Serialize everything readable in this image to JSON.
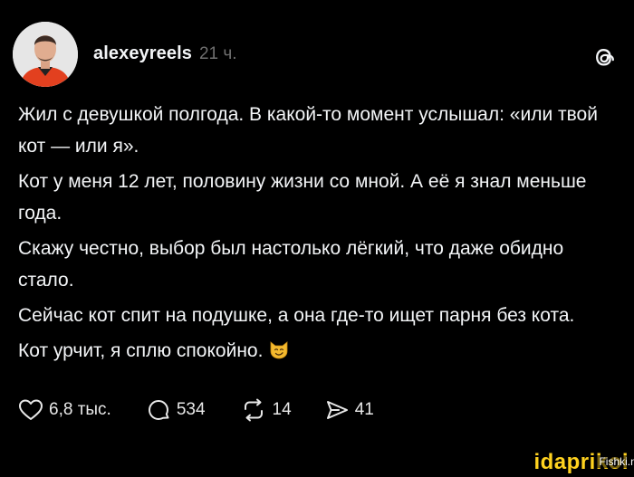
{
  "post": {
    "username": "alexeyreels",
    "timestamp": "21 ч.",
    "paragraphs": [
      "Жил с девушкой полгода. В какой-то момент услышал: «или твой кот — или я».",
      "Кот у меня 12 лет, половину жизни со мной. А её я знал меньше года.",
      "Скажу честно, выбор был настолько лёгкий, что даже обидно стало.",
      "Сейчас кот спит на подушке, а она где-то ищет парня без кота.",
      "Кот урчит, я сплю спокойно."
    ],
    "emoji": "smirking-cat-emoji"
  },
  "actions": {
    "likes": "6,8 тыс.",
    "comments": "534",
    "reposts": "14",
    "shares": "41"
  },
  "icons": {
    "like": "heart-icon",
    "comment": "comment-bubble-icon",
    "repost": "repost-arrows-icon",
    "share": "send-arrow-icon",
    "brand": "threads-logo-icon"
  },
  "watermark": {
    "main": "idaprikol",
    "secondary": "Fishki.net"
  },
  "colors": {
    "background": "#000000",
    "text": "#f3f5f7",
    "muted": "#6f6f6f",
    "watermark": "#ffd21f"
  }
}
